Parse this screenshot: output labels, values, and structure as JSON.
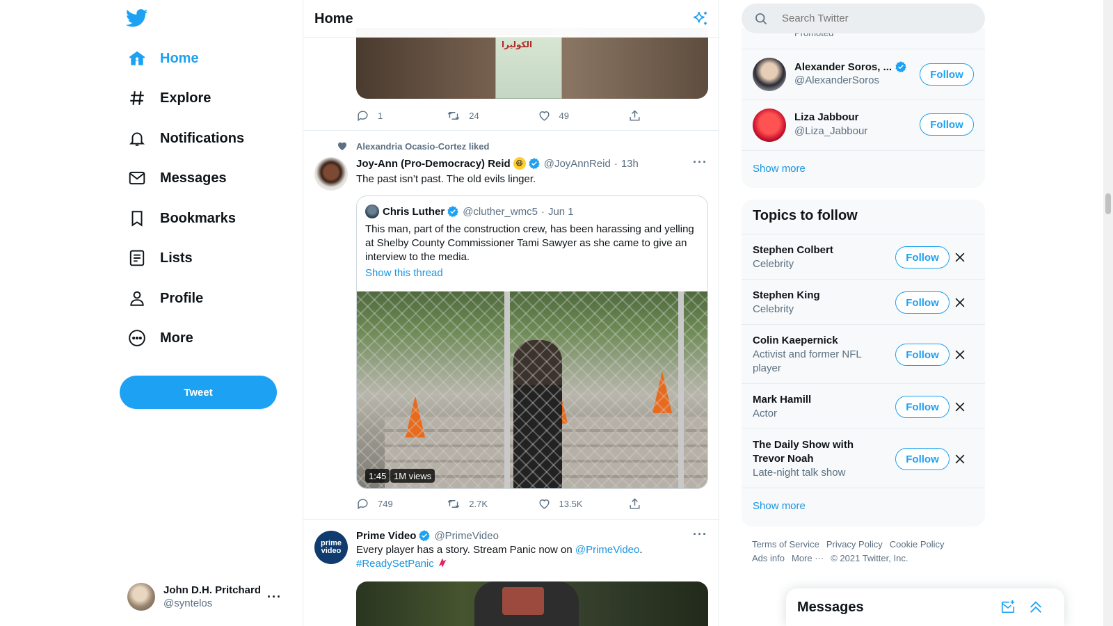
{
  "nav": {
    "items": [
      {
        "label": "Home",
        "icon": "home-icon"
      },
      {
        "label": "Explore",
        "icon": "hashtag-icon"
      },
      {
        "label": "Notifications",
        "icon": "bell-icon"
      },
      {
        "label": "Messages",
        "icon": "envelope-icon"
      },
      {
        "label": "Bookmarks",
        "icon": "bookmark-icon"
      },
      {
        "label": "Lists",
        "icon": "list-icon"
      },
      {
        "label": "Profile",
        "icon": "person-icon"
      },
      {
        "label": "More",
        "icon": "more-circle-icon"
      }
    ],
    "tweet_button": "Tweet",
    "account": {
      "name": "John D.H. Pritchard",
      "handle": "@syntelos",
      "more": "···"
    }
  },
  "header": {
    "title": "Home"
  },
  "feed": {
    "prev_tweet": {
      "replies": "1",
      "retweets": "24",
      "likes": "49"
    },
    "tweet1": {
      "social_context": "Alexandria Ocasio-Cortez liked",
      "name": "Joy-Ann (Pro-Democracy) Reid",
      "handle": "@JoyAnnReid",
      "sep": "·",
      "time": "13h",
      "text": "The past isn’t past. The old evils linger.",
      "quote": {
        "name": "Chris Luther",
        "handle": "@cluther_wmc5",
        "sep": "·",
        "time": "Jun 1",
        "text": "This man, part of the construction crew, has been harassing and yelling at Shelby County Commissioner Tami Sawyer as she came to give an interview to the media.",
        "show_thread": "Show this thread",
        "video_duration": "1:45",
        "video_views": "1M views"
      },
      "replies": "749",
      "retweets": "2.7K",
      "likes": "13.5K"
    },
    "tweet2": {
      "name": "Prime Video",
      "handle": "@PrimeVideo",
      "text_before": "Every player has a story. Stream Panic now on ",
      "mention": "@PrimeVideo",
      "text_after": ".",
      "hashtag": "#ReadySetPanic",
      "avatar_text": "prime video"
    }
  },
  "right": {
    "search_placeholder": "Search Twitter",
    "promoted": "Promoted",
    "who_to_follow": [
      {
        "name": "Alexander Soros, ...",
        "handle": "@AlexanderSoros",
        "button": "Follow"
      },
      {
        "name": "Liza Jabbour",
        "handle": "@Liza_Jabbour",
        "button": "Follow"
      }
    ],
    "show_more_1": "Show more",
    "topics_title": "Topics to follow",
    "topics": [
      {
        "name": "Stephen Colbert",
        "category": "Celebrity",
        "button": "Follow"
      },
      {
        "name": "Stephen King",
        "category": "Celebrity",
        "button": "Follow"
      },
      {
        "name": "Colin Kaepernick",
        "category": "Activist and former NFL player",
        "button": "Follow"
      },
      {
        "name": "Mark Hamill",
        "category": "Actor",
        "button": "Follow"
      },
      {
        "name": "The Daily Show with Trevor Noah",
        "category": "Late-night talk show",
        "button": "Follow"
      }
    ],
    "show_more_2": "Show more",
    "footer": {
      "terms": "Terms of Service",
      "privacy": "Privacy Policy",
      "cookie": "Cookie Policy",
      "ads": "Ads info",
      "more": "More ···",
      "copyright": "© 2021 Twitter, Inc."
    }
  },
  "messages_dock": {
    "title": "Messages"
  },
  "colors": {
    "accent": "#1da1f2",
    "text_secondary": "#5b7083",
    "border": "#e6ecf0",
    "panel_bg": "#f7f9fa"
  }
}
